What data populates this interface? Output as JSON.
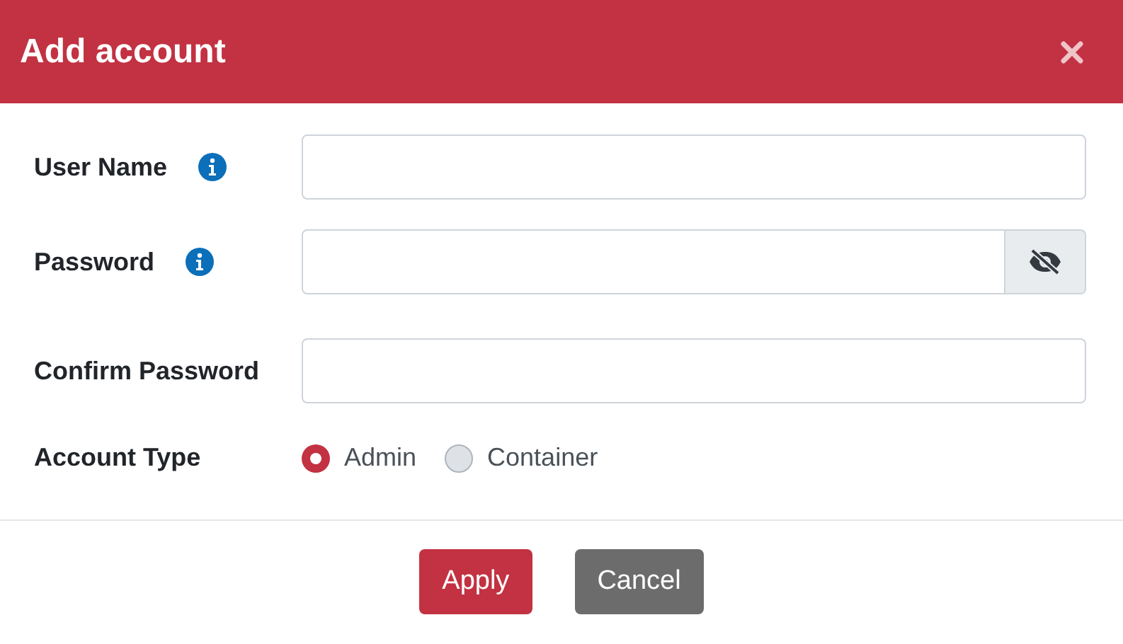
{
  "dialog": {
    "title": "Add account"
  },
  "fields": [
    {
      "kind": "text",
      "label": "User Name",
      "info": true
    },
    {
      "kind": "password",
      "label": "Password",
      "info": true
    },
    {
      "kind": "text",
      "label": "Confirm Password",
      "info": false
    },
    {
      "kind": "radio",
      "label": "Account Type",
      "options": [
        {
          "label": "Admin",
          "selected": true
        },
        {
          "label": "Container",
          "selected": false
        }
      ]
    }
  ],
  "buttons": [
    {
      "label": "Apply",
      "kind": "primary"
    },
    {
      "label": "Cancel",
      "kind": "secondary"
    }
  ]
}
